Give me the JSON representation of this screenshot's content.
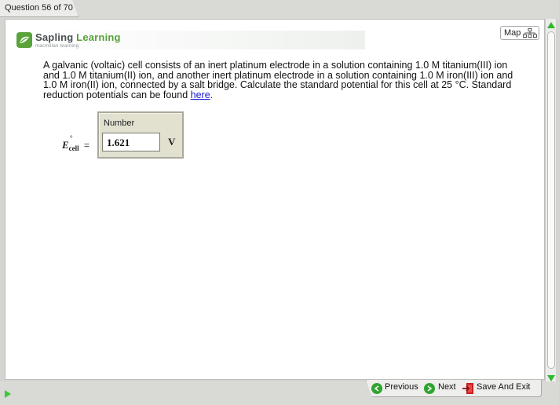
{
  "header": {
    "question_tab": "Question 56 of 70"
  },
  "logo": {
    "brand_part1": "Sapling",
    "brand_part2": "Learning",
    "subtitle": "macmillan learning"
  },
  "map_button": {
    "label": "Map"
  },
  "question": {
    "text": "A galvanic (voltaic) cell consists of an inert platinum electrode in a solution containing 1.0 M titanium(III) ion and 1.0 M titanium(II) ion, and another inert platinum electrode in a solution containing 1.0 M iron(III) ion and 1.0 M iron(II) ion, connected by a salt bridge. Calculate the standard potential for this cell at 25 °C. Standard reduction potentials can be found ",
    "link_text": "here",
    "text_end": "."
  },
  "equation": {
    "symbol": "E",
    "degree": "°",
    "subscript": "cell",
    "equals": "="
  },
  "answer": {
    "caption": "Number",
    "value": "1.621",
    "unit": "V"
  },
  "nav": {
    "previous_label": "Previous",
    "next_label": "Next",
    "save_exit_label": "Save And Exit"
  },
  "colors": {
    "accent_green": "#2fa52f",
    "link_blue": "#1515d6",
    "brand_green": "#56a03a"
  }
}
